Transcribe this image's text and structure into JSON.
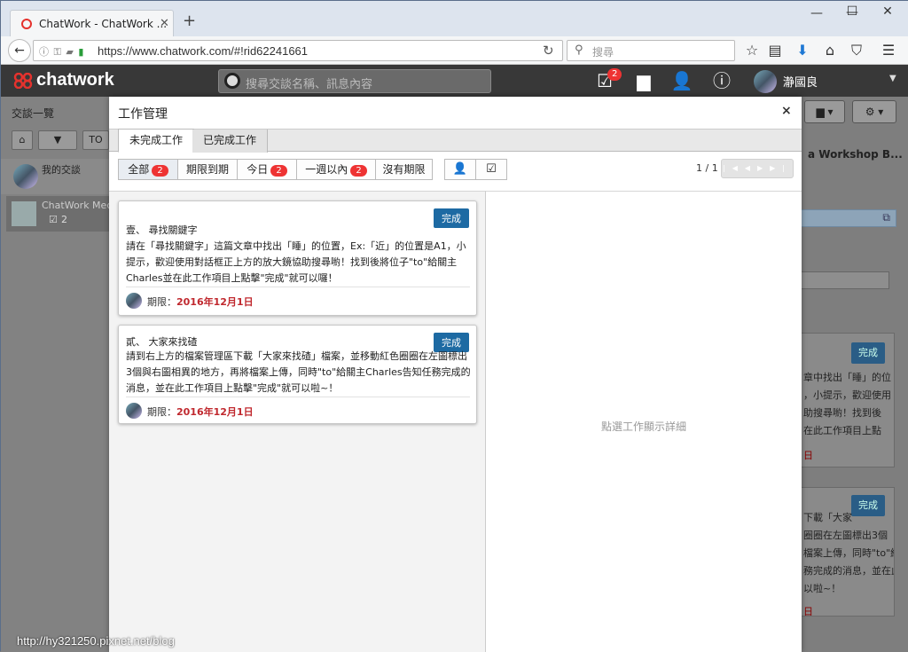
{
  "browser": {
    "tab_title": "ChatWork - ChatWork ...",
    "url": "https://www.chatwork.com/#!rid62241661",
    "search_placeholder": "搜尋"
  },
  "app": {
    "logo_text": "chatwork",
    "search_placeholder": "搜尋交談名稱、訊息內容",
    "task_badge": "2",
    "user_name": "瀞國良"
  },
  "sidebar": {
    "title": "交談一覽",
    "filter_to": "TO",
    "rooms": [
      {
        "name": "我的交談"
      },
      {
        "name": "ChatWork Medi",
        "task_count": "2"
      }
    ]
  },
  "backdrop": {
    "room_title": "a Workshop B...",
    "done_label": "完成",
    "card1_lines": [
      "章中找出「睡」的位",
      "，小提示，歡迎使用",
      "助搜尋喲！找到後",
      "在此工作項目上點"
    ],
    "card1_date_tail": "日",
    "card2_lines": [
      "下載「大家",
      "圈圈在左圖標出3個",
      "檔案上傳，同時\"to\"給",
      "務完成的消息，並在此工",
      "以啦~！"
    ],
    "card2_date_tail": "日"
  },
  "modal": {
    "title": "工作管理",
    "close": "×",
    "tabs": [
      {
        "label": "未完成工作"
      },
      {
        "label": "已完成工作"
      }
    ],
    "filters": [
      {
        "label": "全部",
        "count": "2"
      },
      {
        "label": "期限到期"
      },
      {
        "label": "今日",
        "count": "2"
      },
      {
        "label": "一週以內",
        "count": "2"
      },
      {
        "label": "沒有期限"
      }
    ],
    "pagination": "1 / 1",
    "detail_placeholder": "點選工作顯示詳細",
    "tasks": [
      {
        "title": "壹、  尋找關鍵字",
        "body": "請在「尋找關鍵字」這篇文章中找出「睡」的位置，Ex:「近」的位置是A1，小提示，歡迎使用對話框正上方的放大鏡協助搜尋喲！找到後將位子\"to\"給關主Charles並在此工作項目上點擊\"完成\"就可以囉！",
        "deadline_label": "期限：",
        "deadline": "2016年12月1日",
        "done": "完成"
      },
      {
        "title": "貳、  大家來找碴",
        "body": "請到右上方的檔案管理區下載「大家來找碴」檔案，並移動紅色圈圈在左圖標出3個與右圖相異的地方，再將檔案上傳，同時\"to\"給關主Charles告知任務完成的消息，並在此工作項目上點擊\"完成\"就可以啦~！",
        "deadline_label": "期限：",
        "deadline": "2016年12月1日",
        "done": "完成"
      }
    ]
  },
  "watermark": "http://hy321250.pixnet.net/blog"
}
